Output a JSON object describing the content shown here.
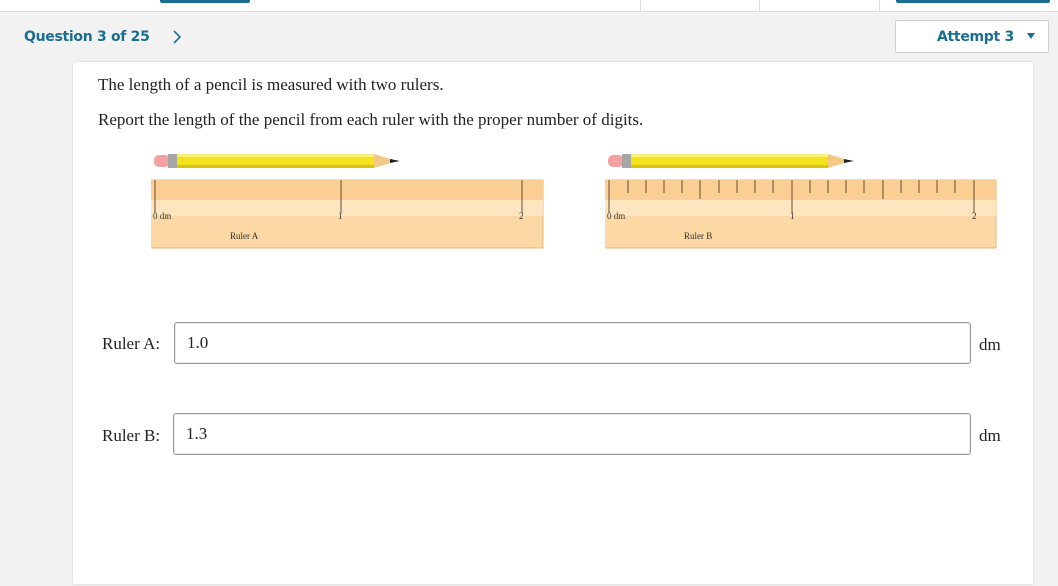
{
  "header": {
    "question_label": "Question 3 of 25",
    "attempt_label": "Attempt 3",
    "accent_color": "#1b6e93"
  },
  "question": {
    "line1": "The length of a pencil is measured with two rulers.",
    "line2": "Report the length of the pencil from each ruler with the proper number of digits."
  },
  "rulers": {
    "a": {
      "caption": "Ruler A",
      "zero_label": "0 dm",
      "mark1": "1",
      "mark2": "2"
    },
    "b": {
      "caption": "Ruler B",
      "zero_label": "0 dm",
      "mark1": "1",
      "mark2": "2"
    }
  },
  "answers": {
    "a": {
      "label": "Ruler A:",
      "value": "1.0",
      "unit": "dm"
    },
    "b": {
      "label": "Ruler B:",
      "value": "1.3",
      "unit": "dm"
    }
  }
}
